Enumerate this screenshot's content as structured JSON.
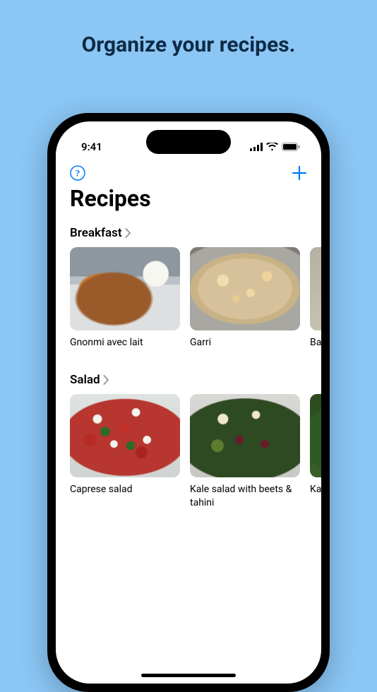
{
  "tagline": "Organize your recipes.",
  "status": {
    "time": "9:41"
  },
  "nav": {
    "help_icon": "help-icon",
    "add_icon": "add-icon"
  },
  "page_title": "Recipes",
  "sections": [
    {
      "title": "Breakfast",
      "recipes": [
        {
          "name": "Gnonmi avec lait",
          "thumb": "thumb-gnonmi"
        },
        {
          "name": "Garri",
          "thumb": "thumb-garri"
        },
        {
          "name": "Bana",
          "thumb": "thumb-bana"
        }
      ]
    },
    {
      "title": "Salad",
      "recipes": [
        {
          "name": "Caprese salad",
          "thumb": "thumb-caprese"
        },
        {
          "name": "Kale salad with beets & tahini",
          "thumb": "thumb-kale"
        },
        {
          "name": "Kale mang",
          "thumb": "thumb-kale-mango"
        }
      ]
    }
  ]
}
